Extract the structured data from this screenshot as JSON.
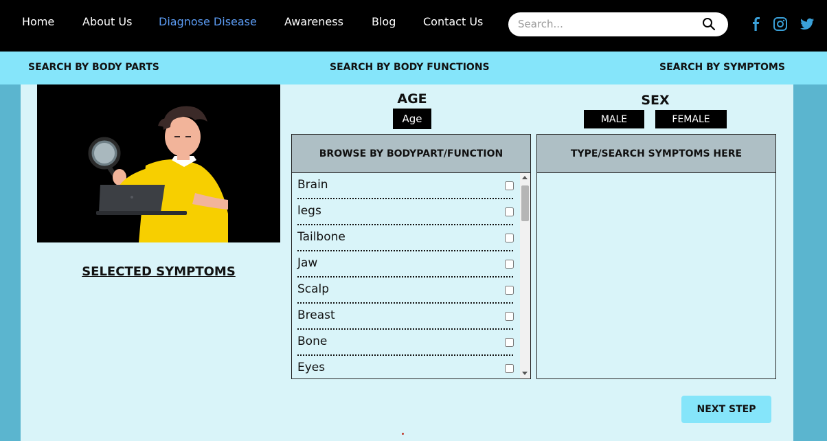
{
  "nav": {
    "items": [
      {
        "label": "Home"
      },
      {
        "label": "About Us"
      },
      {
        "label": "Diagnose Disease"
      },
      {
        "label": "Awareness"
      },
      {
        "label": "Blog"
      },
      {
        "label": "Contact Us"
      }
    ],
    "active_label": "Diagnose Disease",
    "search": {
      "placeholder": "Search...",
      "value": ""
    },
    "social": [
      "facebook-icon",
      "instagram-icon",
      "twitter-icon"
    ],
    "social_color": "#3aa0d8",
    "active_color": "#5b9bf2"
  },
  "subnav": {
    "items": [
      {
        "label": "SEARCH BY BODY PARTS"
      },
      {
        "label": "SEARCH BY BODY FUNCTIONS"
      },
      {
        "label": "SEARCH BY SYMPTOMS"
      }
    ],
    "background": "#85e5fa"
  },
  "main": {
    "selected_symptoms_title": "SELECTED SYMPTOMS",
    "age": {
      "title": "AGE",
      "button_label": "Age"
    },
    "sex": {
      "title": "SEX",
      "options": [
        "MALE",
        "FEMALE"
      ]
    },
    "browse": {
      "header": "BROWSE BY BODYPART/FUNCTION",
      "items": [
        {
          "label": "Brain",
          "checked": false
        },
        {
          "label": "legs",
          "checked": false
        },
        {
          "label": "Tailbone",
          "checked": false
        },
        {
          "label": "Jaw",
          "checked": false
        },
        {
          "label": "Scalp",
          "checked": false
        },
        {
          "label": "Breast",
          "checked": false
        },
        {
          "label": "Bone",
          "checked": false
        },
        {
          "label": "Eyes",
          "checked": false
        }
      ]
    },
    "symptoms": {
      "header": "TYPE/SEARCH SYMPTOMS HERE"
    },
    "next_label": "NEXT STEP"
  }
}
